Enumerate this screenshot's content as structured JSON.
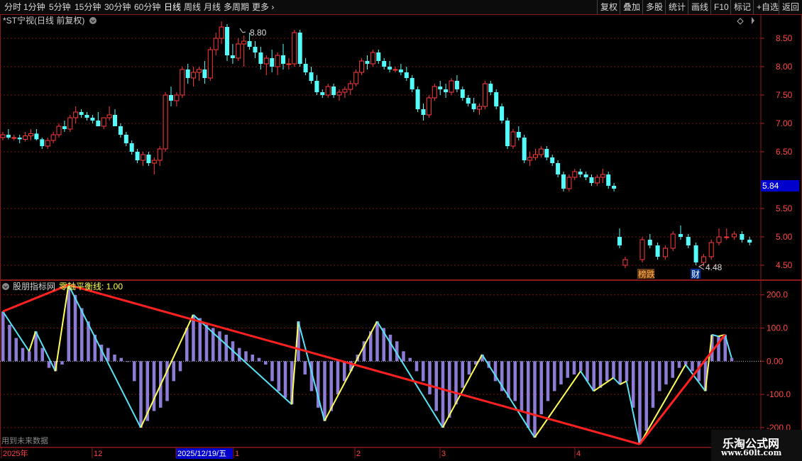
{
  "toolbar": {
    "left": [
      "分时",
      "1分钟",
      "5分钟",
      "15分钟",
      "30分钟",
      "60分钟",
      "日线",
      "周线",
      "月线",
      "多周期",
      "更多"
    ],
    "active": "日线",
    "right": [
      "复权",
      "叠加",
      "多股",
      "统计",
      "画线",
      "F10",
      "标记",
      "+自选",
      "返回"
    ]
  },
  "stock": {
    "title": "*ST宁视(日线 前复权)",
    "high_label": "8.80",
    "low_label": "4.48",
    "current_price": "5.84",
    "price_ticks": [
      "8.50",
      "8.00",
      "7.50",
      "7.00",
      "6.50",
      "5.50",
      "5.00",
      "4.50"
    ],
    "badges": [
      "榜跌",
      "财"
    ]
  },
  "indicator": {
    "name": "股朋指标网",
    "param_label": "零轴平衡线: 1.00",
    "ticks": [
      "200.0",
      "100.0",
      "0.00",
      "-100.0",
      "-200.0"
    ],
    "note": "用到未来数据"
  },
  "timeline": {
    "labels": [
      "2025年",
      "12",
      "2025/12/19/五",
      "1",
      "2",
      "3",
      "4"
    ]
  },
  "watermark": {
    "line1": "乐淘公式网",
    "line2": "www.60lt.com"
  },
  "colors": {
    "up": "#ff3b3b",
    "down": "#54fcfc",
    "frame": "#8a1a1a",
    "histogram": "#8d7cd6",
    "zigzag_a": "#ffff55",
    "zigzag_b": "#55e3f5",
    "trend": "#ff2020",
    "price_box": "#0000cc"
  },
  "chart_data": [
    {
      "type": "candlestick",
      "title": "*ST宁视(日线 前复权)",
      "ylim": [
        4.25,
        8.9
      ],
      "y_ticks": [
        4.5,
        5.0,
        5.5,
        6.5,
        7.0,
        7.5,
        8.0,
        8.5
      ],
      "ohlc": [
        [
          6.75,
          6.85,
          6.7,
          6.8
        ],
        [
          6.8,
          6.9,
          6.72,
          6.75
        ],
        [
          6.75,
          6.8,
          6.7,
          6.75
        ],
        [
          6.75,
          6.8,
          6.65,
          6.72
        ],
        [
          6.72,
          6.85,
          6.68,
          6.78
        ],
        [
          6.78,
          6.9,
          6.7,
          6.82
        ],
        [
          6.82,
          6.9,
          6.7,
          6.72
        ],
        [
          6.72,
          6.75,
          6.55,
          6.6
        ],
        [
          6.6,
          6.75,
          6.55,
          6.7
        ],
        [
          6.7,
          6.85,
          6.65,
          6.8
        ],
        [
          6.8,
          7.0,
          6.75,
          6.95
        ],
        [
          6.95,
          7.05,
          6.85,
          6.9
        ],
        [
          6.9,
          7.15,
          6.85,
          7.1
        ],
        [
          7.1,
          7.3,
          7.0,
          7.2
        ],
        [
          7.2,
          7.25,
          7.1,
          7.15
        ],
        [
          7.15,
          7.2,
          7.05,
          7.1
        ],
        [
          7.1,
          7.15,
          7.0,
          7.05
        ],
        [
          7.05,
          7.2,
          6.95,
          6.95
        ],
        [
          6.95,
          7.05,
          6.9,
          7.1
        ],
        [
          7.1,
          7.3,
          7.05,
          7.15
        ],
        [
          7.15,
          7.25,
          6.95,
          6.95
        ],
        [
          6.95,
          7.0,
          6.75,
          6.8
        ],
        [
          6.8,
          6.85,
          6.6,
          6.65
        ],
        [
          6.65,
          6.7,
          6.45,
          6.5
        ],
        [
          6.5,
          6.55,
          6.3,
          6.35
        ],
        [
          6.35,
          6.5,
          6.25,
          6.45
        ],
        [
          6.45,
          6.5,
          6.25,
          6.3
        ],
        [
          6.3,
          6.4,
          6.1,
          6.35
        ],
        [
          6.35,
          6.6,
          6.25,
          6.55
        ],
        [
          6.55,
          7.55,
          6.5,
          7.5
        ],
        [
          7.5,
          7.65,
          7.3,
          7.4
        ],
        [
          7.4,
          7.55,
          7.3,
          7.5
        ],
        [
          7.5,
          8.0,
          7.45,
          7.95
        ],
        [
          7.95,
          8.05,
          7.7,
          7.8
        ],
        [
          7.8,
          8.0,
          7.65,
          7.9
        ],
        [
          7.9,
          8.0,
          7.75,
          7.95
        ],
        [
          7.95,
          8.1,
          7.7,
          7.8
        ],
        [
          7.8,
          8.35,
          7.75,
          8.3
        ],
        [
          8.3,
          8.6,
          8.2,
          8.5
        ],
        [
          8.5,
          8.8,
          8.4,
          8.7
        ],
        [
          8.7,
          8.75,
          8.1,
          8.2
        ],
        [
          8.2,
          8.4,
          8.05,
          8.15
        ],
        [
          8.15,
          8.5,
          8.1,
          8.4
        ],
        [
          8.4,
          8.55,
          8.0,
          8.45
        ],
        [
          8.45,
          8.6,
          8.3,
          8.35
        ],
        [
          8.35,
          8.45,
          8.15,
          8.25
        ],
        [
          8.25,
          8.35,
          7.95,
          8.05
        ],
        [
          8.05,
          8.2,
          7.85,
          8.15
        ],
        [
          8.15,
          8.3,
          7.9,
          8.0
        ],
        [
          8.0,
          8.25,
          7.85,
          8.2
        ],
        [
          8.2,
          8.4,
          7.95,
          8.05
        ],
        [
          8.05,
          8.15,
          7.95,
          8.05
        ],
        [
          8.05,
          8.65,
          8.0,
          8.6
        ],
        [
          8.6,
          8.65,
          8.0,
          8.05
        ],
        [
          8.05,
          8.15,
          7.85,
          7.9
        ],
        [
          7.9,
          8.0,
          7.7,
          7.75
        ],
        [
          7.75,
          7.85,
          7.5,
          7.55
        ],
        [
          7.55,
          7.6,
          7.45,
          7.5
        ],
        [
          7.5,
          7.7,
          7.45,
          7.65
        ],
        [
          7.65,
          7.7,
          7.45,
          7.5
        ],
        [
          7.5,
          7.6,
          7.4,
          7.55
        ],
        [
          7.55,
          7.65,
          7.45,
          7.6
        ],
        [
          7.6,
          7.75,
          7.5,
          7.7
        ],
        [
          7.7,
          7.95,
          7.65,
          7.9
        ],
        [
          7.9,
          8.15,
          7.85,
          8.1
        ],
        [
          8.1,
          8.2,
          7.95,
          8.05
        ],
        [
          8.05,
          8.3,
          8.0,
          8.25
        ],
        [
          8.25,
          8.3,
          8.05,
          8.1
        ],
        [
          8.1,
          8.15,
          7.95,
          8.0
        ],
        [
          8.0,
          8.1,
          7.9,
          7.95
        ],
        [
          7.95,
          8.0,
          7.9,
          7.95
        ],
        [
          7.95,
          8.05,
          7.85,
          7.9
        ],
        [
          7.9,
          8.0,
          7.75,
          7.8
        ],
        [
          7.8,
          7.85,
          7.55,
          7.6
        ],
        [
          7.6,
          7.65,
          7.2,
          7.25
        ],
        [
          7.25,
          7.35,
          7.05,
          7.15
        ],
        [
          7.15,
          7.5,
          7.1,
          7.45
        ],
        [
          7.45,
          7.7,
          7.4,
          7.65
        ],
        [
          7.65,
          7.75,
          7.5,
          7.6
        ],
        [
          7.6,
          7.7,
          7.45,
          7.55
        ],
        [
          7.55,
          7.8,
          7.5,
          7.75
        ],
        [
          7.75,
          7.85,
          7.55,
          7.6
        ],
        [
          7.6,
          7.65,
          7.4,
          7.45
        ],
        [
          7.45,
          7.5,
          7.3,
          7.35
        ],
        [
          7.35,
          7.45,
          7.2,
          7.25
        ],
        [
          7.25,
          7.35,
          7.15,
          7.3
        ],
        [
          7.3,
          7.75,
          7.25,
          7.7
        ],
        [
          7.7,
          7.75,
          7.5,
          7.55
        ],
        [
          7.55,
          7.6,
          7.25,
          7.3
        ],
        [
          7.3,
          7.35,
          7.0,
          7.05
        ],
        [
          7.05,
          7.1,
          6.55,
          6.6
        ],
        [
          6.6,
          6.9,
          6.55,
          6.85
        ],
        [
          6.85,
          6.95,
          6.7,
          6.75
        ],
        [
          6.75,
          6.8,
          6.3,
          6.35
        ],
        [
          6.35,
          6.5,
          6.25,
          6.4
        ],
        [
          6.4,
          6.55,
          6.35,
          6.45
        ],
        [
          6.45,
          6.6,
          6.4,
          6.55
        ],
        [
          6.55,
          6.6,
          6.35,
          6.4
        ],
        [
          6.4,
          6.45,
          6.25,
          6.3
        ],
        [
          6.3,
          6.35,
          6.05,
          6.1
        ],
        [
          6.1,
          6.15,
          5.8,
          5.85
        ],
        [
          5.85,
          6.1,
          5.8,
          6.05
        ],
        [
          6.05,
          6.2,
          6.0,
          6.15
        ],
        [
          6.15,
          6.2,
          6.05,
          6.1
        ],
        [
          6.1,
          6.15,
          6.0,
          6.05
        ],
        [
          6.05,
          6.1,
          5.9,
          5.95
        ],
        [
          5.95,
          6.1,
          5.9,
          6.05
        ],
        [
          6.05,
          6.2,
          5.95,
          6.1
        ],
        [
          6.1,
          6.15,
          5.85,
          5.9
        ],
        [
          5.9,
          5.95,
          5.8,
          5.85
        ],
        [
          5.0,
          5.15,
          4.8,
          4.85
        ],
        [
          4.5,
          4.65,
          4.45,
          4.6
        ],
        [
          4.6,
          5.0,
          4.55,
          4.95
        ],
        [
          4.95,
          5.05,
          4.8,
          4.85
        ],
        [
          4.85,
          4.9,
          4.6,
          4.65
        ],
        [
          4.65,
          4.85,
          4.6,
          4.8
        ],
        [
          4.8,
          5.1,
          4.75,
          5.05
        ],
        [
          5.05,
          5.2,
          4.95,
          5.0
        ],
        [
          5.0,
          5.05,
          4.8,
          4.85
        ],
        [
          4.85,
          4.9,
          4.5,
          4.55
        ],
        [
          4.55,
          4.7,
          4.48,
          4.65
        ],
        [
          4.65,
          4.95,
          4.6,
          4.9
        ],
        [
          4.9,
          5.15,
          4.85,
          5.0
        ],
        [
          5.0,
          5.15,
          4.95,
          5.0
        ],
        [
          5.0,
          5.1,
          4.95,
          5.05
        ],
        [
          5.05,
          5.1,
          4.9,
          4.95
        ],
        [
          4.95,
          5.0,
          4.85,
          4.9
        ]
      ]
    },
    {
      "type": "bar",
      "title": "股朋指标网",
      "ylim": [
        -260,
        240
      ],
      "y_ticks": [
        200,
        100,
        0,
        -100,
        -200
      ],
      "values": [
        150,
        110,
        70,
        40,
        30,
        90,
        40,
        -20,
        -30,
        -10,
        230,
        200,
        160,
        120,
        80,
        50,
        40,
        20,
        10,
        0,
        -60,
        -200,
        -180,
        -150,
        -140,
        -120,
        -60,
        -30,
        100,
        140,
        130,
        110,
        100,
        90,
        80,
        60,
        40,
        30,
        20,
        10,
        -10,
        -60,
        -90,
        -110,
        -130,
        120,
        -40,
        -90,
        -140,
        -180,
        -150,
        -100,
        -60,
        -30,
        20,
        60,
        90,
        120,
        100,
        80,
        60,
        30,
        10,
        -30,
        -60,
        -100,
        -150,
        -200,
        -170,
        -130,
        -80,
        -40,
        -10,
        20,
        -20,
        -60,
        -90,
        -110,
        -120,
        -150,
        -200,
        -230,
        -160,
        -120,
        -90,
        -70,
        -50,
        -40,
        -30,
        -60,
        -90,
        -80,
        -60,
        -50,
        -70,
        -60,
        -140,
        -250,
        -210,
        -140,
        -90,
        -70,
        -50,
        -20,
        -10,
        -30,
        -60,
        -90,
        80,
        75,
        80,
        10
      ]
    }
  ]
}
